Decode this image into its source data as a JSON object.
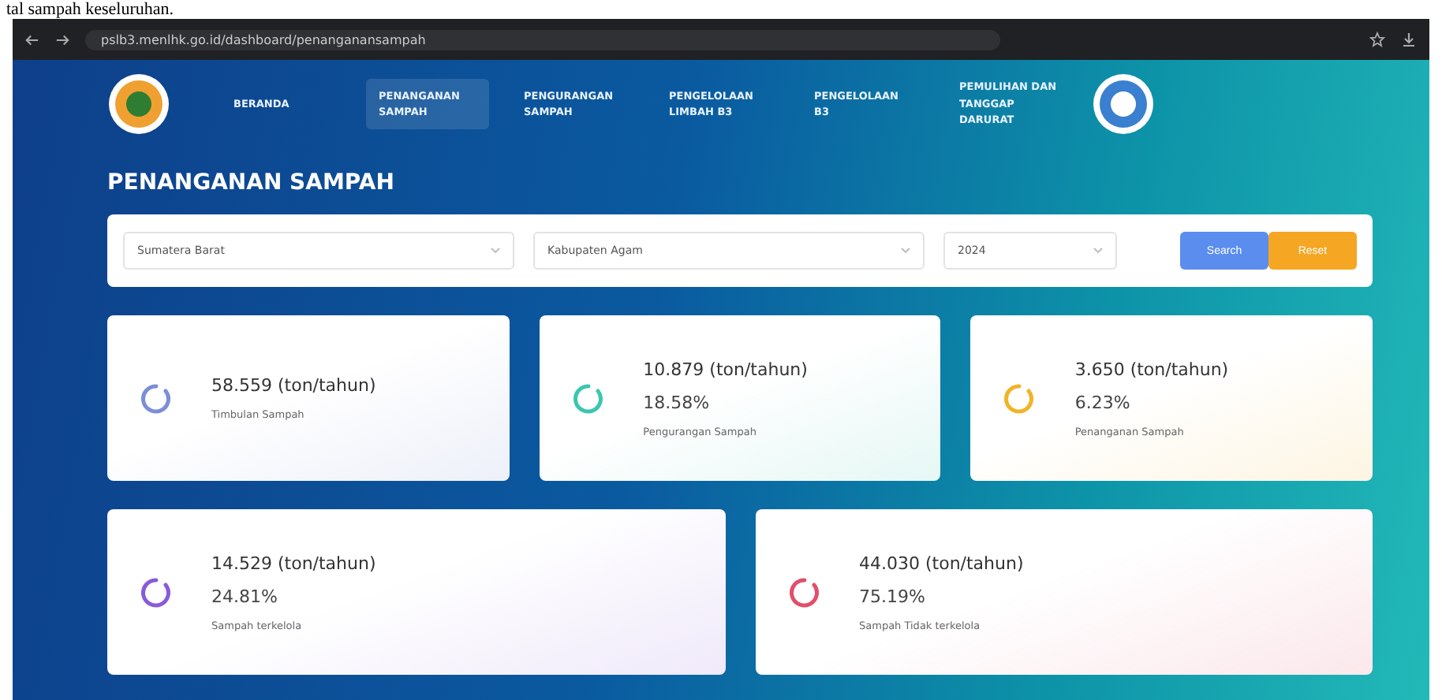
{
  "caption": "tal sampah keseluruhan.",
  "browser": {
    "url": "pslb3.menlhk.go.id/dashboard/penanganansampah"
  },
  "nav": [
    {
      "label": "BERANDA",
      "selected": false
    },
    {
      "label": "PENANGANAN SAMPAH",
      "selected": true
    },
    {
      "label": "PENGURANGAN SAMPAH",
      "selected": false
    },
    {
      "label": "PENGELOLAAN LIMBAH B3",
      "selected": false
    },
    {
      "label": "PENGELOLAAN B3",
      "selected": false
    },
    {
      "label": "PEMULIHAN DAN TANGGAP DARURAT",
      "selected": false
    }
  ],
  "page_title": "PENANGANAN SAMPAH",
  "filters": [
    {
      "value": "Sumatera Barat"
    },
    {
      "value": "Kabupaten Agam"
    },
    {
      "value": "2024"
    }
  ],
  "buttons": [
    {
      "label": "Search",
      "kind": "primary"
    },
    {
      "label": "Reset",
      "kind": "warning"
    }
  ],
  "stats_top": [
    {
      "amount": "58.559 (ton/tahun)",
      "label": "Timbulan Sampah",
      "color": "#7b8fd6"
    },
    {
      "amount": "10.879 (ton/tahun)",
      "percent": "18.58%",
      "label": "Pengurangan Sampah",
      "color": "#3cc6b0"
    },
    {
      "amount": "3.650 (ton/tahun)",
      "percent": "6.23%",
      "label": "Penanganan Sampah",
      "color": "#f0b429"
    }
  ],
  "stats_bottom": [
    {
      "amount": "14.529 (ton/tahun)",
      "percent": "24.81%",
      "label": "Sampah terkelola",
      "color": "#8a5bd8"
    },
    {
      "amount": "44.030 (ton/tahun)",
      "percent": "75.19%",
      "label": "Sampah Tidak terkelola",
      "color": "#e0506a"
    }
  ]
}
